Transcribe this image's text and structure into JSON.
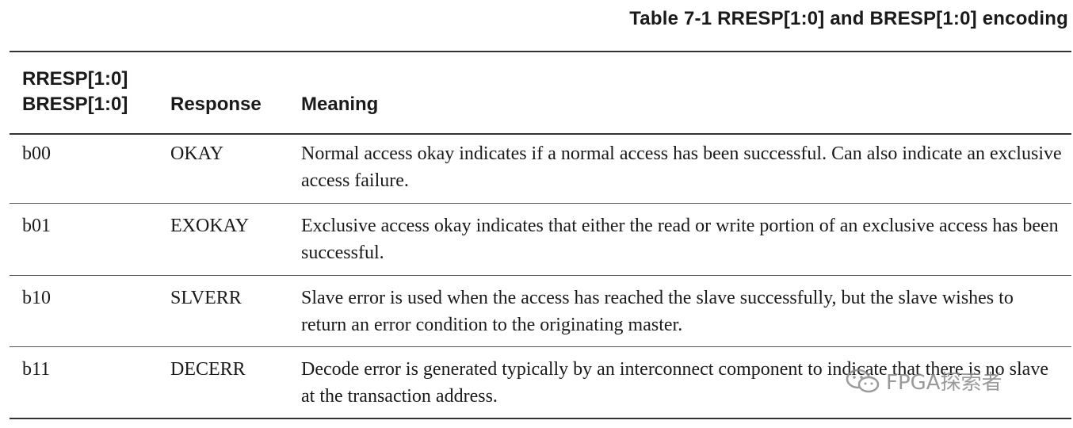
{
  "table": {
    "caption": "Table 7-1 RRESP[1:0] and BRESP[1:0] encoding",
    "headers": {
      "code_line1": "RRESP[1:0]",
      "code_line2": "BRESP[1:0]",
      "response": "Response",
      "meaning": "Meaning"
    },
    "rows": [
      {
        "code": "b00",
        "response": "OKAY",
        "meaning": "Normal access okay indicates if a normal access has been successful. Can also indicate an exclusive access failure."
      },
      {
        "code": "b01",
        "response": "EXOKAY",
        "meaning": "Exclusive access okay indicates that either the read or write portion of an exclusive access has been successful."
      },
      {
        "code": "b10",
        "response": "SLVERR",
        "meaning": "Slave error is used when the access has reached the slave successfully, but the slave wishes to return an error condition to the originating master."
      },
      {
        "code": "b11",
        "response": "DECERR",
        "meaning": "Decode error is generated typically by an interconnect component to indicate that there is no slave at the transaction address."
      }
    ]
  },
  "watermark": {
    "text": "FPGA探索者",
    "icon": "wechat-icon"
  }
}
